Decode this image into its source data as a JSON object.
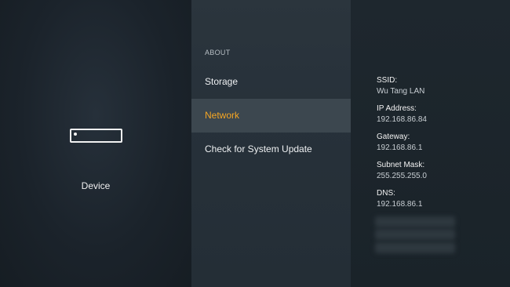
{
  "device_panel": {
    "label": "Device",
    "icon": "fire-tv-stick-icon"
  },
  "about_menu": {
    "header": "ABOUT",
    "items": [
      {
        "label": "Storage"
      },
      {
        "label": "Network"
      },
      {
        "label": "Check for System Update"
      }
    ],
    "selected_index": 1,
    "selected_color": "#f5a623"
  },
  "network_info": {
    "fields": [
      {
        "label": "SSID:",
        "value": "Wu Tang LAN"
      },
      {
        "label": "IP Address:",
        "value": "192.168.86.84"
      },
      {
        "label": "Gateway:",
        "value": "192.168.86.1"
      },
      {
        "label": "Subnet Mask:",
        "value": "255.255.255.0"
      },
      {
        "label": "DNS:",
        "value": "192.168.86.1"
      }
    ]
  }
}
